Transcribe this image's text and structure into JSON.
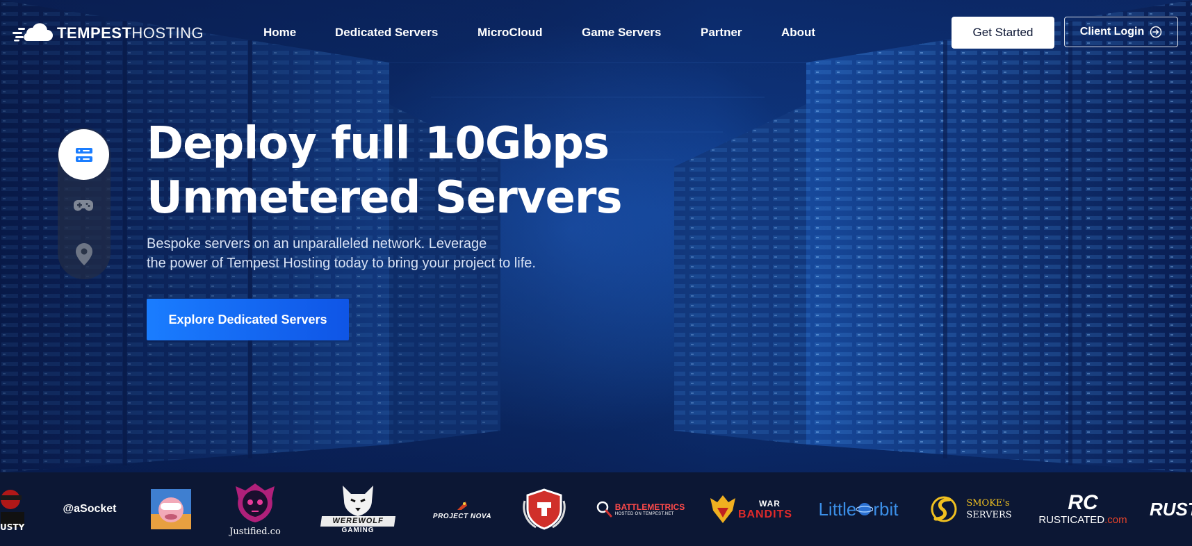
{
  "brand": {
    "name_bold": "TEMPEST",
    "name_light": "HOSTING",
    "icon": "cloud-logo-icon"
  },
  "nav": {
    "items": [
      {
        "label": "Home"
      },
      {
        "label": "Dedicated Servers"
      },
      {
        "label": "MicroCloud"
      },
      {
        "label": "Game Servers"
      },
      {
        "label": "Partner"
      },
      {
        "label": "About"
      }
    ]
  },
  "header": {
    "get_started_label": "Get Started",
    "client_login_label": "Client Login",
    "client_login_icon": "sign-in-icon"
  },
  "side_nav": {
    "items": [
      {
        "icon": "server-icon",
        "active": true
      },
      {
        "icon": "gamepad-icon",
        "active": false
      },
      {
        "icon": "map-pin-icon",
        "active": false
      }
    ]
  },
  "hero": {
    "headline_line1": "Deploy full 10Gbps",
    "headline_line2": "Unmetered Servers",
    "subtitle_line1": "Bespoke servers on an unparalleled network. Leverage",
    "subtitle_line2": "the power of Tempest Hosting today to bring your project to life.",
    "cta_label": "Explore Dedicated Servers"
  },
  "partners": {
    "asocket": "@aSocket",
    "justified": "Justified.co",
    "werewolf_line1": "WEREWOLF",
    "werewolf_line2": "GAMING",
    "project_nova": "PROJECT NOVA",
    "battlemetrics": "BATTLEMETRICS",
    "battlemetrics_sub": "HOSTED ON TEMPEST.NET",
    "war_bandits_top": "WAR",
    "war_bandits_bottom": "BANDITS",
    "littleorbit_a": "Little",
    "littleorbit_b": "rbit",
    "smokes_line1": "SMOKE's",
    "smokes_line2": "SERVERS",
    "rusticated_mark": "RC",
    "rusticated_name": "RUSTICATED",
    "rusticated_tld": ".com",
    "rust_partial": "RUST",
    "rusty_partial": "USTY"
  },
  "colors": {
    "accent_start": "#1a7dff",
    "accent_end": "#0f55e6",
    "hero_bg": "#0d3275",
    "strip_bg": "#0c1734"
  }
}
